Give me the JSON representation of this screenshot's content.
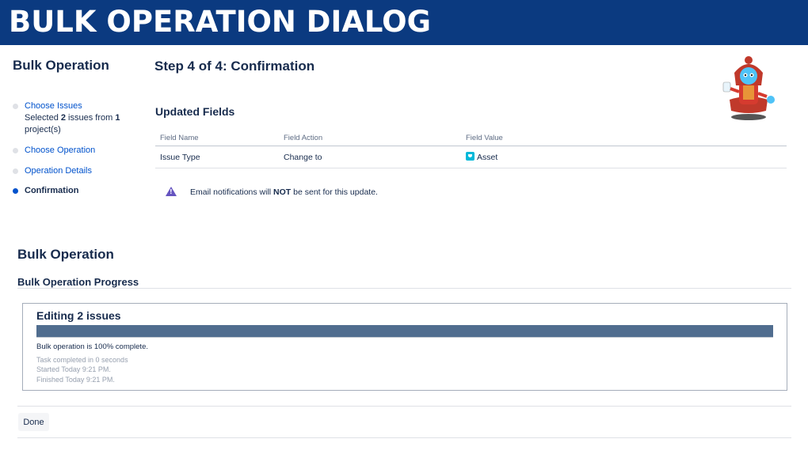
{
  "banner": {
    "title": "BULK OPERATION DIALOG"
  },
  "sidebar": {
    "title": "Bulk Operation",
    "steps": [
      {
        "label": "Choose Issues",
        "desc_pre": "Selected ",
        "desc_count": "2",
        "desc_mid": " issues from ",
        "desc_projects": "1",
        "desc_post": " project(s)"
      },
      {
        "label": "Choose Operation"
      },
      {
        "label": "Operation Details"
      },
      {
        "label": "Confirmation"
      }
    ]
  },
  "main": {
    "step_title": "Step 4 of 4: Confirmation",
    "updated_fields_title": "Updated Fields",
    "table": {
      "headers": [
        "Field Name",
        "Field Action",
        "Field Value"
      ],
      "rows": [
        {
          "name": "Issue Type",
          "action": "Change to",
          "value": "Asset",
          "value_icon": "asset-icon"
        }
      ]
    },
    "notice": {
      "pre": "Email notifications will ",
      "emphasis": "NOT",
      "post": " be sent for this update.",
      "icon": "warning-icon"
    }
  },
  "progress_section": {
    "title": "Bulk Operation",
    "subtitle": "Bulk Operation Progress",
    "box_title": "Editing 2 issues",
    "percent": 100,
    "status": "Bulk operation is 100% complete.",
    "task_completed": "Task completed in 0 seconds",
    "started": "Started Today 9:21 PM.",
    "finished": "Finished Today 9:21 PM."
  },
  "footer": {
    "done_label": "Done"
  },
  "colors": {
    "banner": "#0b3a80",
    "link": "#0052cc",
    "progress_fill": "#506d8f",
    "warning": "#6554c0",
    "asset": "#00b8d9"
  }
}
